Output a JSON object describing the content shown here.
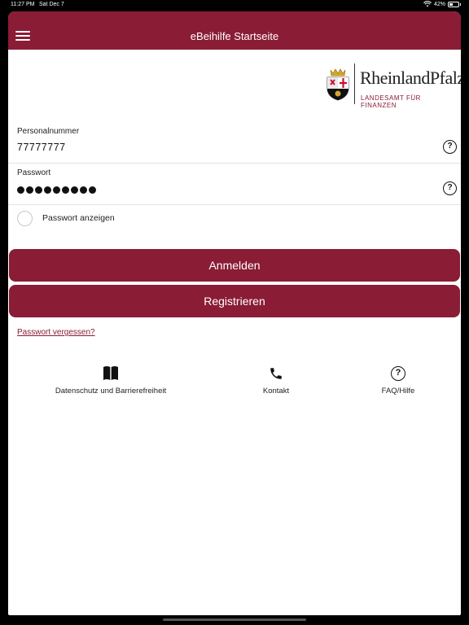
{
  "status_bar": {
    "time": "11:27 PM",
    "date": "Sat Dec 7",
    "battery": "42%",
    "battery_level": 0.42
  },
  "navbar": {
    "title": "eBeihilfe Startseite",
    "menu_icon": "hamburger-icon"
  },
  "logo": {
    "wordmark": "RheinlandPfalz",
    "subtitle": "LANDESAMT FÜR FINANZEN"
  },
  "login": {
    "personalnummer_label": "Personalnummer",
    "personalnummer_value": "77777777",
    "passwort_label": "Passwort",
    "passwort_masked_length": 9,
    "show_password_label": "Passwort anzeigen",
    "help_icon": "question-circle-icon"
  },
  "buttons": {
    "login": "Anmelden",
    "register": "Registrieren"
  },
  "forgot_password": "Passwort vergessen?",
  "bottom_links": [
    {
      "label": "Datenschutz und Barrierefreiheit",
      "icon": "book-icon"
    },
    {
      "label": "Kontakt",
      "icon": "phone-icon"
    },
    {
      "label": "FAQ/Hilfe",
      "icon": "question-circle-icon"
    }
  ],
  "colors": {
    "brand": "#8a1c36"
  }
}
